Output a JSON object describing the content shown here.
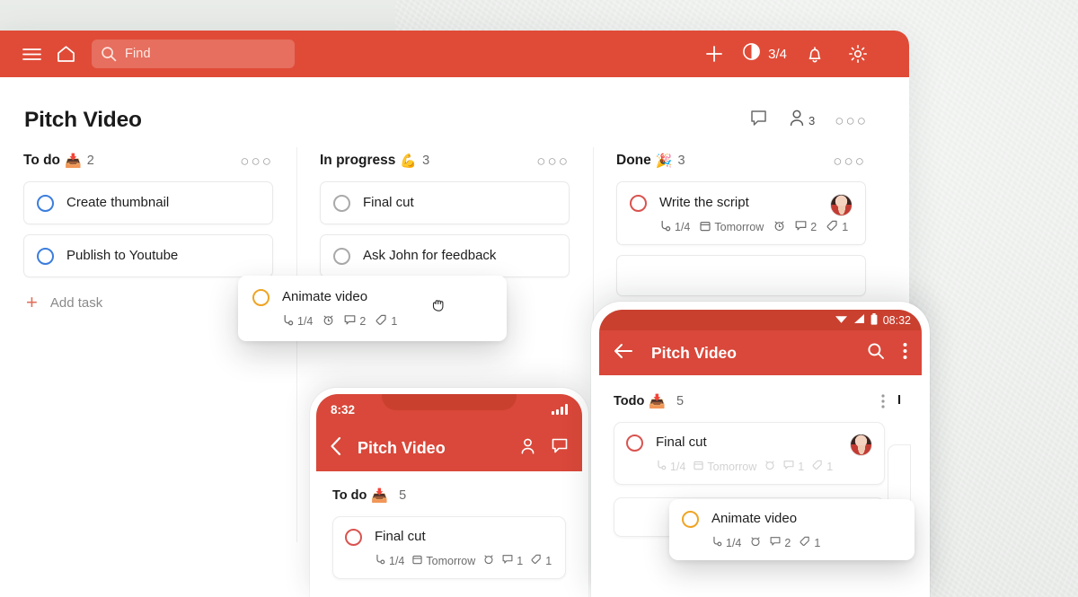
{
  "desktop": {
    "topbar": {
      "menu_icon": "hamburger-icon",
      "home_icon": "home-icon",
      "search_placeholder": "Find",
      "add_icon": "plus-icon",
      "progress_label": "3/4",
      "progress_icon": "pie-progress-icon",
      "bell_icon": "bell-icon",
      "settings_icon": "gear-icon",
      "bg_color": "#e04b37"
    },
    "header": {
      "title": "Pitch Video",
      "comment_icon": "comment-icon",
      "members_icon": "person-icon",
      "members_count": "3",
      "more_label": "○○○"
    },
    "columns": [
      {
        "name": "To do",
        "emoji": "📥",
        "count": "2",
        "more_label": "○○○",
        "ring_color": "#3b7ddd",
        "cards": [
          {
            "title": "Create thumbnail"
          },
          {
            "title": "Publish to Youtube"
          }
        ],
        "add_task_label": "Add task",
        "add_task_plus": "+"
      },
      {
        "name": "In progress",
        "emoji": "💪",
        "count": "3",
        "more_label": "○○○",
        "ring_color": "#a9a9a9",
        "cards": [
          {
            "title": "Final cut"
          },
          {
            "title": "Ask John for feedback"
          }
        ]
      },
      {
        "name": "Done",
        "emoji": "🎉",
        "count": "3",
        "more_label": "○○○",
        "ring_color": "#d9534f",
        "cards": [
          {
            "title": "Write the script",
            "subtasks": "1/4",
            "due": "Tomorrow",
            "comments": "2",
            "tags": "1",
            "has_avatar": true
          }
        ]
      }
    ],
    "drag_card": {
      "title": "Animate video",
      "subtasks": "1/4",
      "comments": "2",
      "tags": "1",
      "ring_color": "#efa423",
      "cursor_icon": "grabbing-hand-cursor"
    }
  },
  "phone_ios": {
    "status_time": "8:32",
    "signal_icon": "signal-bars-icon",
    "back_icon": "chevron-left-icon",
    "title": "Pitch Video",
    "person_icon": "person-icon",
    "comment_icon": "comment-icon",
    "section_name": "To do",
    "section_emoji": "📥",
    "section_count": "5",
    "card": {
      "title": "Final cut",
      "subtasks": "1/4",
      "due": "Tomorrow",
      "alarm_icon": "alarm-icon",
      "comments": "1",
      "tags": "1"
    }
  },
  "phone_android": {
    "status_time": "08:32",
    "wifi_icon": "wifi-icon",
    "signal_icon": "signal-triangle-icon",
    "battery_icon": "battery-icon",
    "back_icon": "arrow-left-icon",
    "title": "Pitch Video",
    "search_icon": "search-icon",
    "overflow_icon": "vertical-dots-icon",
    "section_name": "Todo",
    "section_emoji": "📥",
    "section_count": "5",
    "next_section_name": "I",
    "card": {
      "title": "Final cut",
      "subtasks": "1/4",
      "due": "Tomorrow",
      "comments": "1",
      "tags": "1",
      "has_avatar": true
    },
    "drag_card": {
      "title": "Animate video",
      "subtasks": "1/4",
      "comments": "2",
      "tags": "1",
      "ring_color": "#efa423"
    }
  }
}
